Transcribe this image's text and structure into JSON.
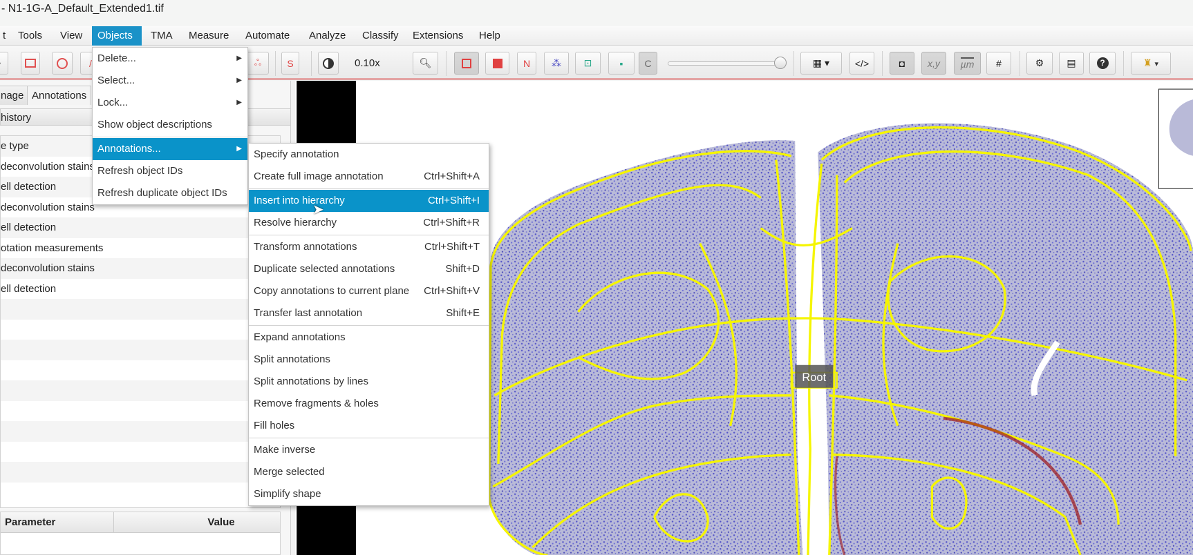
{
  "window": {
    "title": "- N1-1G-A_Default_Extended1.tif"
  },
  "menubar": [
    "t",
    "Tools",
    "View",
    "Objects",
    "TMA",
    "Measure",
    "Automate",
    "Analyze",
    "Classify",
    "Extensions",
    "Help"
  ],
  "toolbar": {
    "zoom_label": "0.10x",
    "stain_s": "S",
    "names_n": "N",
    "c_label": "C",
    "xy_label": "x,y",
    "um_label": "µm",
    "slider_value": 1.0
  },
  "left_panel": {
    "tabs": [
      "nage",
      "Annotations"
    ],
    "history_header": "history",
    "history_items": [
      "e type",
      "deconvolution stains",
      "ell detection",
      "deconvolution stains",
      "ell detection",
      "otation measurements",
      "deconvolution stains",
      "ell detection"
    ],
    "params_header": {
      "parameter": "Parameter",
      "value": "Value"
    }
  },
  "objects_menu": [
    {
      "label": "Delete...",
      "submenu": true
    },
    {
      "label": "Select...",
      "submenu": true
    },
    {
      "label": "Lock...",
      "submenu": true
    },
    {
      "label": "Show object descriptions"
    },
    {
      "sep": true
    },
    {
      "label": "Annotations...",
      "submenu": true,
      "highlighted": true
    },
    {
      "label": "Refresh object IDs"
    },
    {
      "label": "Refresh duplicate object IDs"
    }
  ],
  "annotations_menu": [
    {
      "label": "Specify annotation"
    },
    {
      "label": "Create full image annotation",
      "shortcut": "Ctrl+Shift+A"
    },
    {
      "sep": true
    },
    {
      "label": "Insert into hierarchy",
      "shortcut": "Ctrl+Shift+I",
      "highlighted": true
    },
    {
      "label": "Resolve hierarchy",
      "shortcut": "Ctrl+Shift+R"
    },
    {
      "sep": true
    },
    {
      "label": "Transform annotations",
      "shortcut": "Ctrl+Shift+T"
    },
    {
      "label": "Duplicate selected annotations",
      "shortcut": "Shift+D"
    },
    {
      "label": "Copy annotations to current plane",
      "shortcut": "Ctrl+Shift+V"
    },
    {
      "label": "Transfer last annotation",
      "shortcut": "Shift+E"
    },
    {
      "sep": true
    },
    {
      "label": "Expand annotations"
    },
    {
      "label": "Split annotations"
    },
    {
      "label": "Split annotations by lines"
    },
    {
      "label": "Remove fragments & holes"
    },
    {
      "label": "Fill holes"
    },
    {
      "sep": true
    },
    {
      "label": "Make inverse"
    },
    {
      "label": "Merge selected"
    },
    {
      "label": "Simplify shape"
    }
  ],
  "viewer": {
    "root_label": "Root"
  },
  "colors": {
    "accent": "#0a93c9",
    "annotation": "#f5f500",
    "tissue": "#b7b8d9"
  }
}
